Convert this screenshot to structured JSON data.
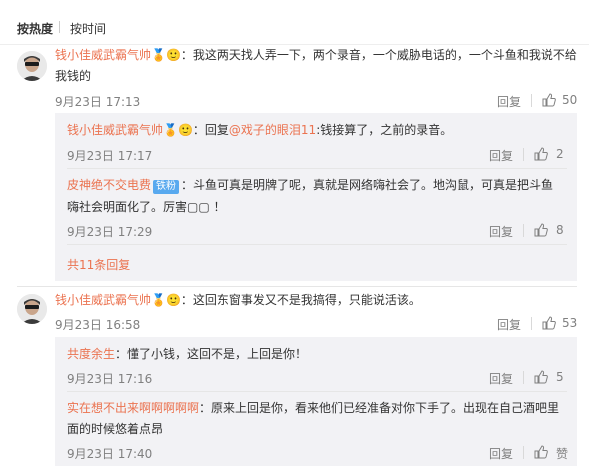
{
  "sort": {
    "hot": "按热度",
    "time": "按时间"
  },
  "comments": [
    {
      "user": "钱小佳威武霸气帅",
      "badge": "🏅🙂",
      "text_line1": "：我这两天找人弄一下，两个录音，一个威胁电话的，一个斗鱼和我说不给",
      "text_line2": "我钱的",
      "time": "9月23日 17:13",
      "reply_label": "回复",
      "likes": "50",
      "replies": [
        {
          "user": "钱小佳威武霸气帅",
          "badge": "🏅🙂",
          "reply_prefix": "：回复",
          "mention": "@戏子的眼泪11",
          "text": ":钱接算了，之前的录音。",
          "time": "9月23日 17:17",
          "reply_label": "回复",
          "likes": "2"
        },
        {
          "user": "皮神绝不交电费",
          "fan_badge": "铁粉",
          "text_line1": "：斗鱼可真是明牌了呢，真就是网络嗨社会了。地沟鼠，可真是把斗鱼",
          "text_line2": "嗨社会明面化了。厉害▢▢ ！",
          "time": "9月23日 17:29",
          "reply_label": "回复",
          "likes": "8"
        }
      ],
      "more_replies": "共11条回复"
    },
    {
      "user": "钱小佳威武霸气帅",
      "badge": "🏅🙂",
      "text_line1": "：这回东窗事发又不是我搞得，只能说活该。",
      "time": "9月23日 16:58",
      "reply_label": "回复",
      "likes": "53",
      "replies": [
        {
          "user": "共度余生",
          "text": "：懂了小钱，这回不是，上回是你！",
          "time": "9月23日 17:16",
          "reply_label": "回复",
          "likes": "5"
        },
        {
          "user": "实在想不出来啊啊啊啊啊",
          "text_line1": "：原来上回是你，看来他们已经准备对你下手了。出现在自己酒吧里",
          "text_line2": "面的时候悠着点昂",
          "time": "9月23日 17:40",
          "reply_label": "回复",
          "likes": "赞"
        }
      ]
    }
  ]
}
